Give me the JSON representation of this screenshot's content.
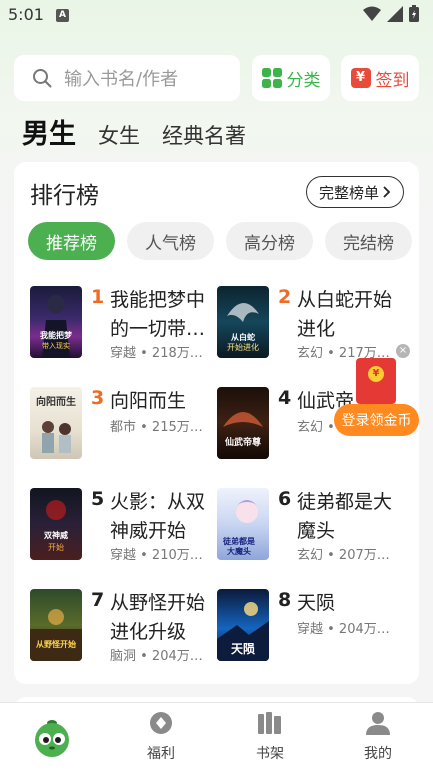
{
  "status_bar": {
    "time": "5:01",
    "notification_icon": "A"
  },
  "search": {
    "placeholder": "输入书名/作者"
  },
  "top_buttons": {
    "category": "分类",
    "signin": "签到",
    "signin_icon_char": "¥"
  },
  "gender_tabs": [
    {
      "label": "男生",
      "active": true
    },
    {
      "label": "女生",
      "active": false
    },
    {
      "label": "经典名著",
      "active": false
    }
  ],
  "ranking": {
    "title": "排行榜",
    "full_list": "完整榜单",
    "chips": [
      {
        "label": "推荐榜",
        "active": true
      },
      {
        "label": "人气榜",
        "active": false
      },
      {
        "label": "高分榜",
        "active": false
      },
      {
        "label": "完结榜",
        "active": false
      }
    ],
    "books": [
      {
        "rank": "1",
        "title": "我能把梦中的一切带…",
        "meta": "穿越 • 218万…"
      },
      {
        "rank": "2",
        "title": "从白蛇开始进化",
        "meta": "玄幻 • 217万…"
      },
      {
        "rank": "3",
        "title": "向阳而生",
        "meta": "都市 • 215万…"
      },
      {
        "rank": "4",
        "title": "仙武帝…",
        "meta": "玄幻 • 2…"
      },
      {
        "rank": "5",
        "title": "火影：从双神威开始",
        "meta": "穿越 • 210万…"
      },
      {
        "rank": "6",
        "title": "徒弟都是大魔头",
        "meta": "玄幻 • 207万…"
      },
      {
        "rank": "7",
        "title": "从野怪开始进化升级",
        "meta": "脑洞 • 204万…"
      },
      {
        "rank": "8",
        "title": "天陨",
        "meta": "穿越 • 204万…"
      }
    ],
    "covers": [
      {
        "text": "我能把梦中的一切带入现实"
      },
      {
        "text": "从白蛇开始进化"
      },
      {
        "text": "向阳而生"
      },
      {
        "text": "仙武帝尊"
      },
      {
        "text": "火影：从双神威开始"
      },
      {
        "text": "徒弟都是大魔头"
      },
      {
        "text": "从野怪开始进化升级"
      },
      {
        "text": "天陨"
      }
    ]
  },
  "floating": {
    "close": "×",
    "login_coin": "登录领金币"
  },
  "bottom_nav": [
    {
      "label": "",
      "icon": "mascot-icon"
    },
    {
      "label": "福利",
      "icon": "gift-icon"
    },
    {
      "label": "书架",
      "icon": "bookshelf-icon"
    },
    {
      "label": "我的",
      "icon": "profile-icon"
    }
  ],
  "colors": {
    "accent": "#4caf50",
    "rank_hot": "#f06a22",
    "signin": "#e84b3a",
    "coin_button": "#ff8a1f"
  }
}
